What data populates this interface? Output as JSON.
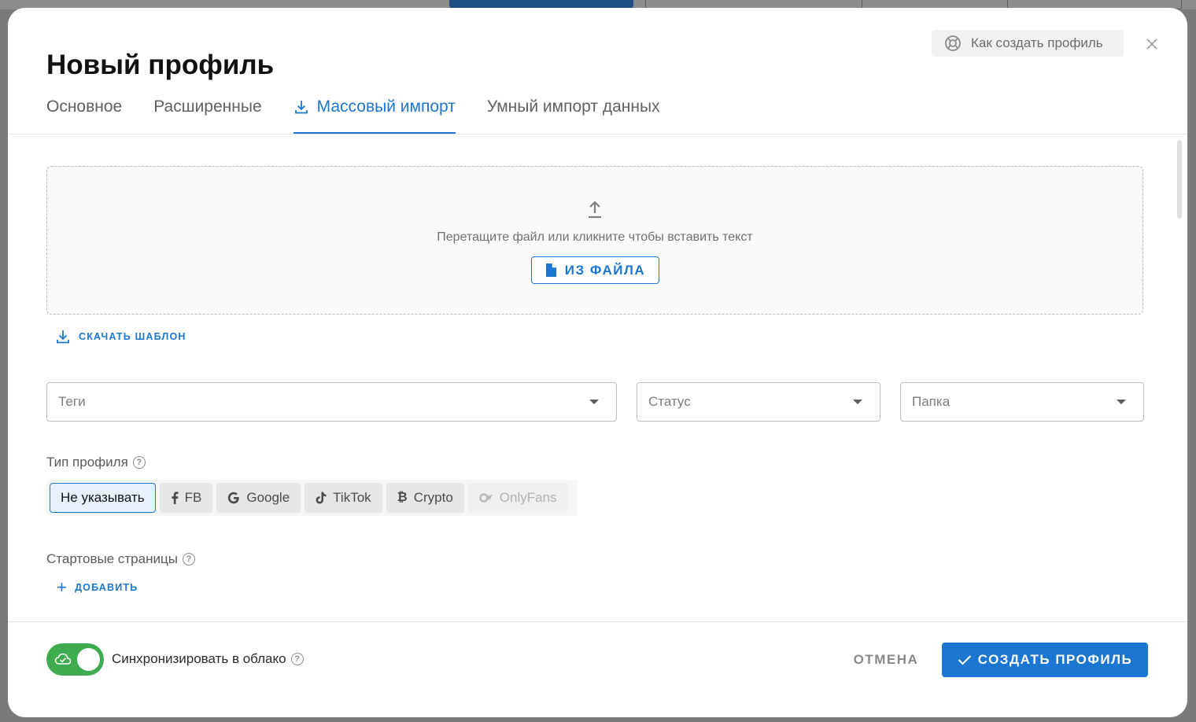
{
  "modal": {
    "title": "Новый профиль",
    "help_label": "Как создать профиль"
  },
  "tabs": [
    {
      "label": "Основное",
      "active": false
    },
    {
      "label": "Расширенные",
      "active": false
    },
    {
      "label": "Массовый импорт",
      "active": true
    },
    {
      "label": "Умный импорт данных",
      "active": false
    }
  ],
  "dropzone": {
    "text": "Перетащите файл или кликните чтобы вставить текст",
    "file_button": "ИЗ ФАЙЛА"
  },
  "template_button": "СКАЧАТЬ ШАБЛОН",
  "selects": {
    "tags_placeholder": "Теги",
    "status_placeholder": "Статус",
    "folder_placeholder": "Папка"
  },
  "profile_type": {
    "label": "Тип профиля",
    "options": [
      {
        "label": "Не указывать",
        "icon": "none",
        "selected": true
      },
      {
        "label": "FB",
        "icon": "facebook-icon"
      },
      {
        "label": "Google",
        "icon": "google-icon"
      },
      {
        "label": "TikTok",
        "icon": "tiktok-icon"
      },
      {
        "label": "Crypto",
        "icon": "bitcoin-icon"
      },
      {
        "label": "OnlyFans",
        "icon": "onlyfans-icon",
        "disabled": true
      }
    ]
  },
  "start_pages": {
    "label": "Стартовые страницы",
    "add_button": "ДОБАВИТЬ"
  },
  "footer": {
    "sync_label": "Синхронизировать в облако",
    "sync_enabled": true,
    "cancel_label": "ОТМЕНА",
    "create_label": "СОЗДАТЬ ПРОФИЛЬ"
  },
  "colors": {
    "accent": "#1b76d2",
    "toggle_on": "#3fab4f"
  }
}
